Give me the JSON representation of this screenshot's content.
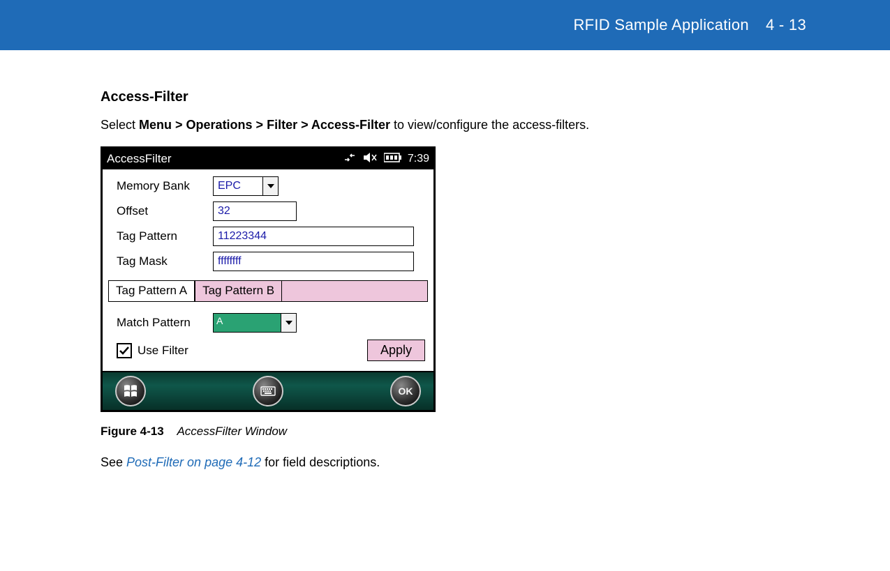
{
  "header": {
    "title": "RFID Sample Application",
    "page": "4 - 13"
  },
  "section": {
    "heading": "Access-Filter",
    "intro_prefix": "Select ",
    "intro_bold": "Menu > Operations > Filter > Access-Filter",
    "intro_suffix": " to view/configure the access-filters."
  },
  "device": {
    "status": {
      "title": "AccessFilter",
      "time": "7:39"
    },
    "fields": {
      "memory_bank": {
        "label": "Memory Bank",
        "value": "EPC"
      },
      "offset": {
        "label": "Offset",
        "value": "32"
      },
      "tag_pattern": {
        "label": "Tag Pattern",
        "value": "11223344"
      },
      "tag_mask": {
        "label": "Tag Mask",
        "value": "ffffffff"
      }
    },
    "tabs": {
      "a": "Tag Pattern A",
      "b": "Tag Pattern B"
    },
    "match": {
      "label": "Match Pattern",
      "value": "A"
    },
    "use_filter": {
      "label": "Use Filter",
      "checked": true
    },
    "apply": "Apply",
    "ok": "OK"
  },
  "figure": {
    "label": "Figure 4-13",
    "title": "AccessFilter Window"
  },
  "see": {
    "prefix": "See ",
    "link": "Post-Filter on page 4-12",
    "suffix": " for field descriptions."
  }
}
